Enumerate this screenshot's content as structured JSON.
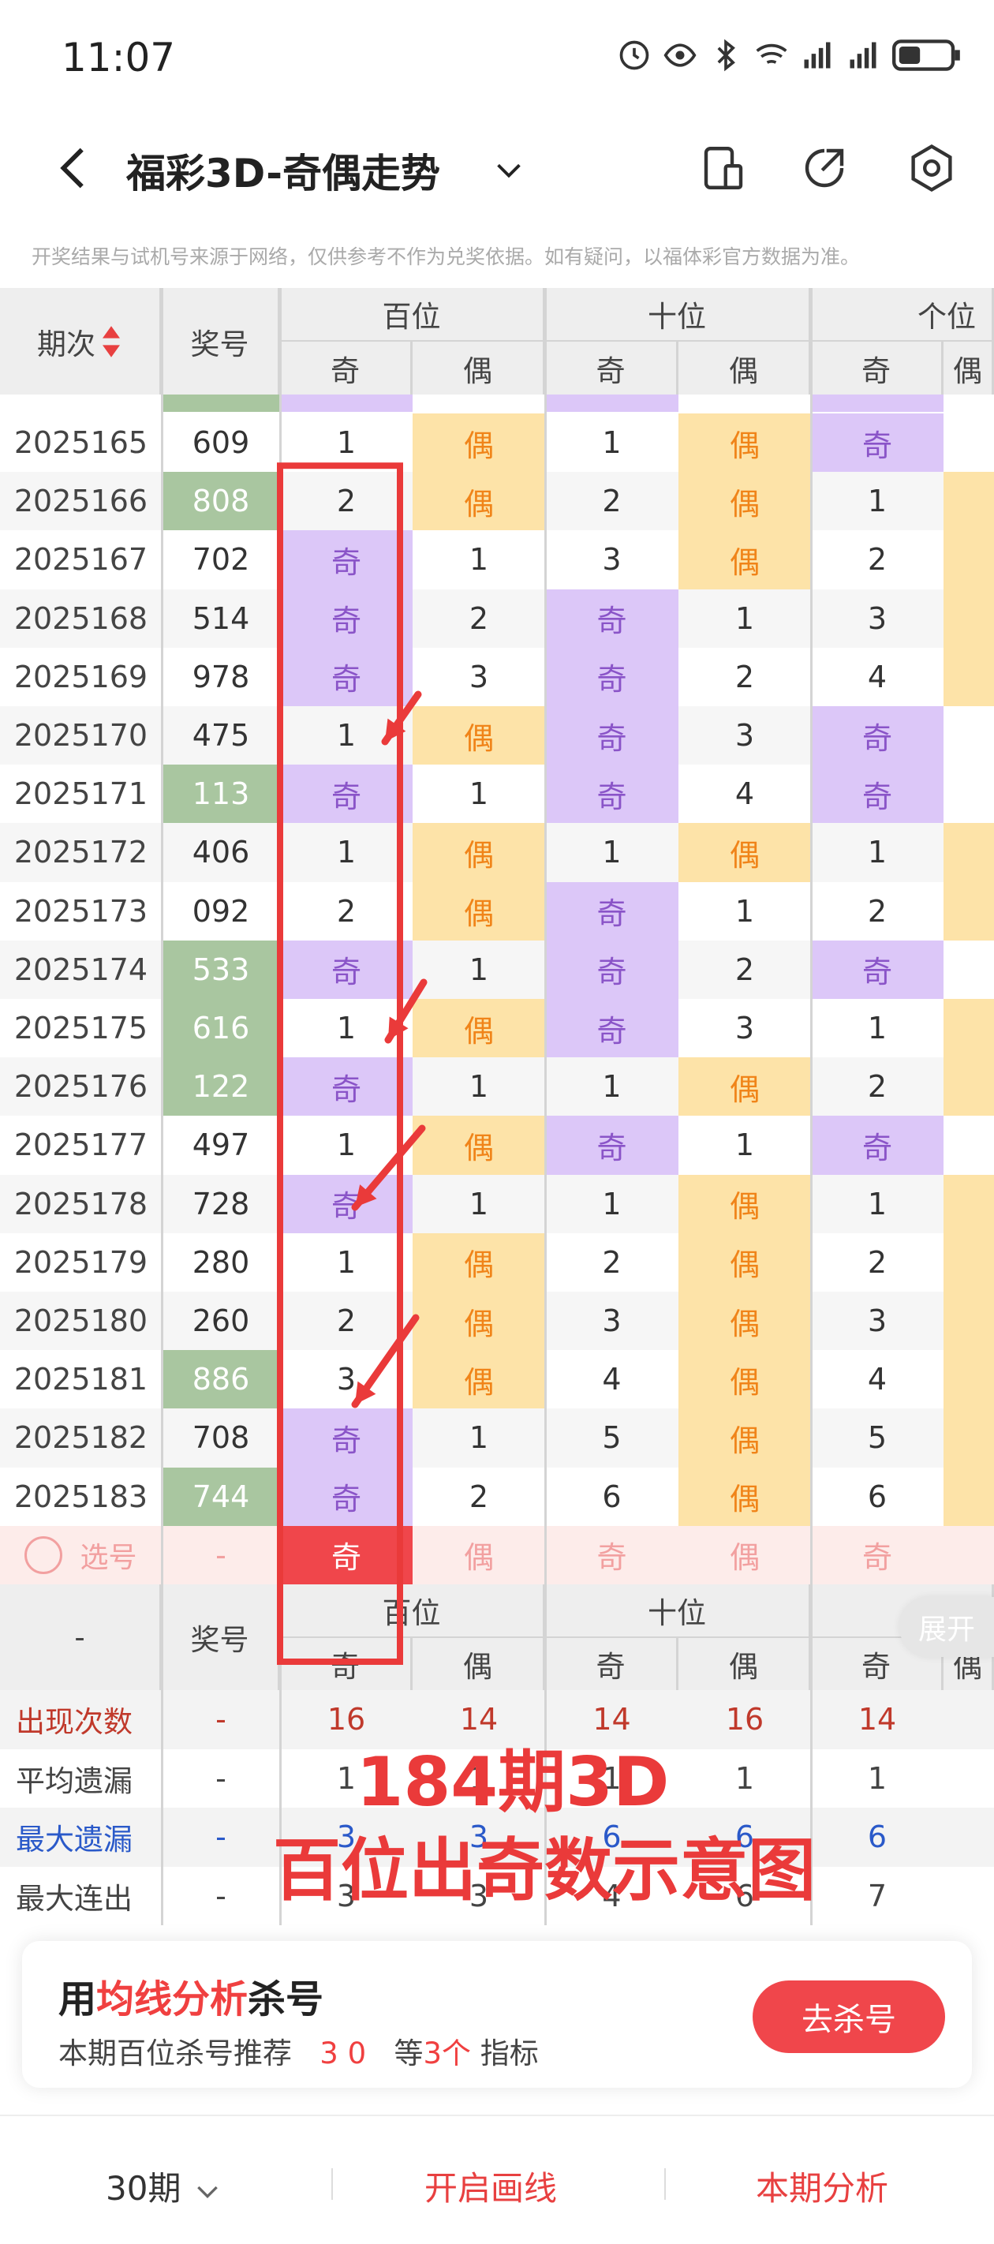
{
  "status": {
    "time": "11:07"
  },
  "appbar": {
    "title": "福彩3D-奇偶走势"
  },
  "disclaimer": "开奖结果与试机号来源于网络，仅供参考不作为兑奖依据。如有疑问，以福体彩官方数据为准。",
  "header": {
    "period": "期次",
    "number": "奖号",
    "groups": [
      "百位",
      "十位",
      "个位"
    ],
    "odd": "奇",
    "even": "偶"
  },
  "rows": [
    {
      "period": "2025165",
      "number": "609",
      "green": false,
      "cells": [
        "1",
        "偶",
        "1",
        "偶",
        "奇"
      ]
    },
    {
      "period": "2025166",
      "number": "808",
      "green": true,
      "cells": [
        "2",
        "偶",
        "2",
        "偶",
        "1"
      ]
    },
    {
      "period": "2025167",
      "number": "702",
      "green": false,
      "cells": [
        "奇",
        "1",
        "3",
        "偶",
        "2"
      ]
    },
    {
      "period": "2025168",
      "number": "514",
      "green": false,
      "cells": [
        "奇",
        "2",
        "奇",
        "1",
        "3"
      ]
    },
    {
      "period": "2025169",
      "number": "978",
      "green": false,
      "cells": [
        "奇",
        "3",
        "奇",
        "2",
        "4"
      ]
    },
    {
      "period": "2025170",
      "number": "475",
      "green": false,
      "cells": [
        "1",
        "偶",
        "奇",
        "3",
        "奇"
      ]
    },
    {
      "period": "2025171",
      "number": "113",
      "green": true,
      "cells": [
        "奇",
        "1",
        "奇",
        "4",
        "奇"
      ]
    },
    {
      "period": "2025172",
      "number": "406",
      "green": false,
      "cells": [
        "1",
        "偶",
        "1",
        "偶",
        "1"
      ]
    },
    {
      "period": "2025173",
      "number": "092",
      "green": false,
      "cells": [
        "2",
        "偶",
        "奇",
        "1",
        "2"
      ]
    },
    {
      "period": "2025174",
      "number": "533",
      "green": true,
      "cells": [
        "奇",
        "1",
        "奇",
        "2",
        "奇"
      ]
    },
    {
      "period": "2025175",
      "number": "616",
      "green": true,
      "cells": [
        "1",
        "偶",
        "奇",
        "3",
        "1"
      ]
    },
    {
      "period": "2025176",
      "number": "122",
      "green": true,
      "cells": [
        "奇",
        "1",
        "1",
        "偶",
        "2"
      ]
    },
    {
      "period": "2025177",
      "number": "497",
      "green": false,
      "cells": [
        "1",
        "偶",
        "奇",
        "1",
        "奇"
      ]
    },
    {
      "period": "2025178",
      "number": "728",
      "green": false,
      "cells": [
        "奇",
        "1",
        "1",
        "偶",
        "1"
      ]
    },
    {
      "period": "2025179",
      "number": "280",
      "green": false,
      "cells": [
        "1",
        "偶",
        "2",
        "偶",
        "2"
      ]
    },
    {
      "period": "2025180",
      "number": "260",
      "green": false,
      "cells": [
        "2",
        "偶",
        "3",
        "偶",
        "3"
      ]
    },
    {
      "period": "2025181",
      "number": "886",
      "green": true,
      "cells": [
        "3",
        "偶",
        "4",
        "偶",
        "4"
      ]
    },
    {
      "period": "2025182",
      "number": "708",
      "green": false,
      "cells": [
        "奇",
        "1",
        "5",
        "偶",
        "5"
      ]
    },
    {
      "period": "2025183",
      "number": "744",
      "green": true,
      "cells": [
        "奇",
        "2",
        "6",
        "偶",
        "6"
      ]
    }
  ],
  "select_row": {
    "label": "选号",
    "number": "-",
    "cells": [
      "奇",
      "偶",
      "奇",
      "偶",
      "奇"
    ]
  },
  "summary": {
    "dash": "-",
    "number": "奖号",
    "expand": "展开",
    "rows": [
      {
        "label": "出现次数",
        "number": "-",
        "cells": [
          "16",
          "14",
          "14",
          "16",
          "14"
        ]
      },
      {
        "label": "平均遗漏",
        "number": "-",
        "cells": [
          "1",
          "1",
          "1",
          "1",
          "1"
        ]
      },
      {
        "label": "最大遗漏",
        "number": "-",
        "cells": [
          "3",
          "3",
          "6",
          "6",
          "6"
        ]
      },
      {
        "label": "最大连出",
        "number": "-",
        "cells": [
          "3",
          "3",
          "4",
          "6",
          "7"
        ]
      }
    ]
  },
  "overlay": {
    "line1": "184期3D",
    "line2": "百位出奇数示意图"
  },
  "card": {
    "line1_a": "用",
    "line1_b": "均线分析",
    "line1_c": "杀号",
    "line2_a": "本期百位杀号推荐",
    "line2_b": "3 0",
    "line2_c": "等",
    "line2_d": "3个",
    "line2_e": "指标",
    "button": "去杀号"
  },
  "bottom": {
    "periods": "30期",
    "draw": "开启画线",
    "analysis": "本期分析"
  },
  "colors": {
    "purple": "#dcc7f8",
    "orange": "#fde3a8",
    "green": "#a9c6a0",
    "accent": "#f0464b"
  }
}
